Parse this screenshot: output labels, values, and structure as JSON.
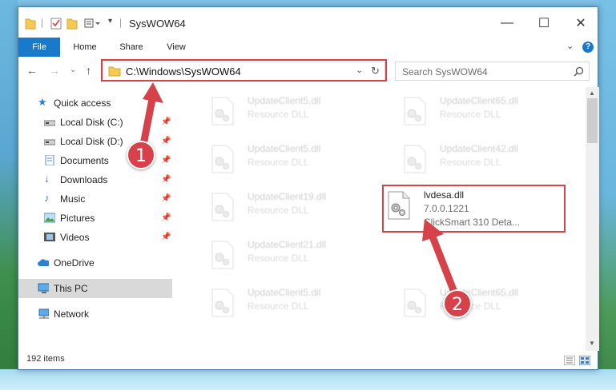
{
  "window": {
    "title": "SysWOW64",
    "minimize_glyph": "—",
    "maximize_glyph": "☐",
    "close_glyph": "✕"
  },
  "ribbon": {
    "tabs": [
      "File",
      "Home",
      "Share",
      "View"
    ],
    "help_glyph": "?"
  },
  "navigation": {
    "address": "C:\\Windows\\SysWOW64",
    "search_placeholder": "Search SysWOW64"
  },
  "sidebar": {
    "items": [
      {
        "label": "Quick access",
        "icon": "star-icon"
      },
      {
        "label": "Local Disk (C:)",
        "icon": "drive-icon",
        "pinned": true
      },
      {
        "label": "Local Disk (D:)",
        "icon": "drive-icon",
        "pinned": true
      },
      {
        "label": "Documents",
        "icon": "documents-icon",
        "pinned": true
      },
      {
        "label": "Downloads",
        "icon": "download-icon",
        "pinned": true
      },
      {
        "label": "Music",
        "icon": "music-icon",
        "pinned": true
      },
      {
        "label": "Pictures",
        "icon": "pictures-icon",
        "pinned": true
      },
      {
        "label": "Videos",
        "icon": "videos-icon",
        "pinned": true
      },
      {
        "label": "OneDrive",
        "icon": "cloud-icon"
      },
      {
        "label": "This PC",
        "icon": "computer-icon",
        "selected": true
      },
      {
        "label": "Network",
        "icon": "network-icon"
      }
    ]
  },
  "files": [
    {
      "name": "UpdateClient5.dll",
      "desc": "Resource DLL",
      "col": 0,
      "row": 0
    },
    {
      "name": "UpdateClient65.dll",
      "desc": "Resource DLL",
      "col": 1,
      "row": 0
    },
    {
      "name": "UpdateClient5.dll",
      "desc": "Resource DLL",
      "col": 0,
      "row": 1
    },
    {
      "name": "UpdateClient42.dll",
      "desc": "Resource DLL",
      "col": 1,
      "row": 1
    },
    {
      "name": "UpdateClient19.dll",
      "desc": "Resource DLL",
      "col": 0,
      "row": 2
    },
    {
      "name": "UpdateClient21.dll",
      "desc": "Resource DLL",
      "col": 0,
      "row": 3
    },
    {
      "name": "UpdateClient5.dll",
      "desc": "Resource DLL",
      "col": 0,
      "row": 4
    },
    {
      "name": "UpdateClient65.dll",
      "desc": "Resource DLL",
      "col": 1,
      "row": 4
    }
  ],
  "highlighted_file": {
    "name": "lvdesa.dll",
    "version": "7.0.0.1221",
    "description": "ClickSmart 310 Deta..."
  },
  "status": {
    "items_count": "192 items"
  },
  "annotations": {
    "badge_1": "1",
    "badge_2": "2",
    "accent_color": "#d7414a"
  }
}
